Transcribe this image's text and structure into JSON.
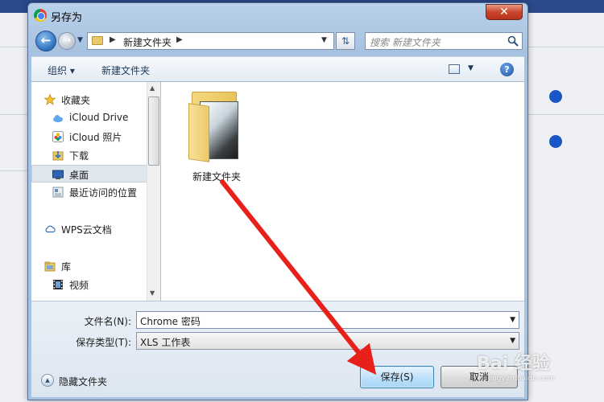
{
  "dialog": {
    "title": "另存为",
    "close_symbol": "✕"
  },
  "address": {
    "crumb": "新建文件夹",
    "search_placeholder": "搜索 新建文件夹"
  },
  "toolbar": {
    "organize": "组织 ▾",
    "new_folder": "新建文件夹",
    "help": "?"
  },
  "nav": {
    "items": [
      {
        "label": "收藏夹",
        "icon": "star-icon"
      },
      {
        "label": "iCloud Drive",
        "icon": "cloud-icon"
      },
      {
        "label": "iCloud 照片",
        "icon": "photos-icon"
      },
      {
        "label": "下载",
        "icon": "download-folder-icon"
      },
      {
        "label": "桌面",
        "icon": "desktop-icon",
        "selected": true
      },
      {
        "label": "最近访问的位置",
        "icon": "recent-places-icon"
      },
      {
        "label": "WPS云文档",
        "icon": "wps-cloud-icon"
      },
      {
        "label": "库",
        "icon": "library-icon"
      },
      {
        "label": "视频",
        "icon": "video-icon"
      }
    ]
  },
  "content": {
    "folder_name": "新建文件夹"
  },
  "form": {
    "filename_label": "文件名(N):",
    "filename_value": "Chrome 密码",
    "filetype_label": "保存类型(T):",
    "filetype_value": "XLS 工作表",
    "hide_folders": "隐藏文件夹",
    "save": "保存(S)",
    "cancel": "取消"
  },
  "watermark": {
    "brand": "Bai 经验",
    "url": "jingyan.baidu.com"
  },
  "colors": {
    "annotation_arrow": "#e8201a",
    "background_toggle": "#1a56c4"
  }
}
